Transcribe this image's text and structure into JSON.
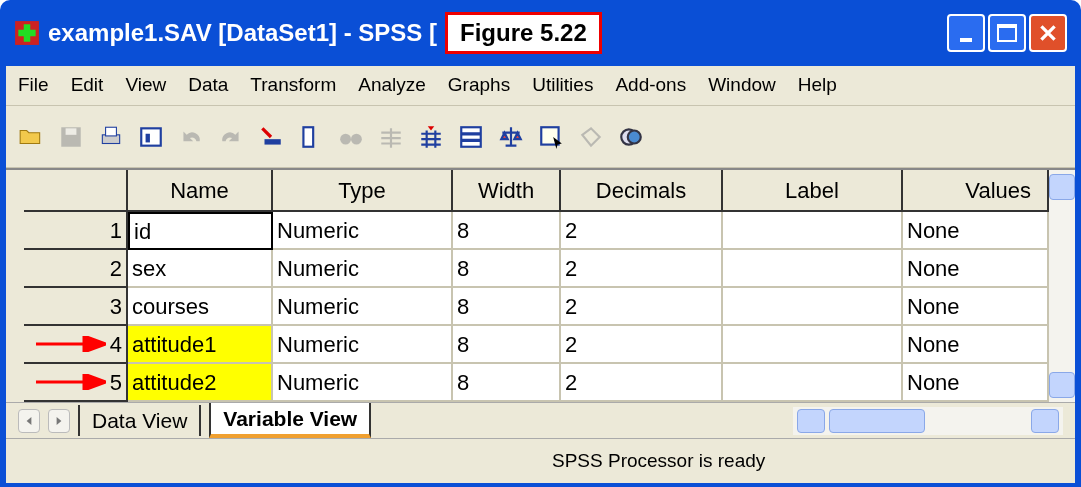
{
  "window": {
    "title": "example1.SAV [DataSet1] - SPSS [",
    "figure_label": "Figure 5.22"
  },
  "menu": [
    "File",
    "Edit",
    "View",
    "Data",
    "Transform",
    "Analyze",
    "Graphs",
    "Utilities",
    "Add-ons",
    "Window",
    "Help"
  ],
  "toolbar": [
    {
      "kind": "open",
      "disabled": false
    },
    {
      "kind": "save",
      "disabled": true
    },
    {
      "kind": "print",
      "disabled": false
    },
    {
      "kind": "dialog",
      "disabled": false
    },
    {
      "kind": "undo",
      "disabled": true
    },
    {
      "kind": "redo",
      "disabled": true
    },
    {
      "kind": "goto",
      "disabled": false
    },
    {
      "kind": "variables",
      "disabled": false
    },
    {
      "kind": "find",
      "disabled": true
    },
    {
      "kind": "insert-cases",
      "disabled": true
    },
    {
      "kind": "insert-variable",
      "disabled": false
    },
    {
      "kind": "split",
      "disabled": false
    },
    {
      "kind": "weight",
      "disabled": false
    },
    {
      "kind": "select",
      "disabled": false
    },
    {
      "kind": "labels",
      "disabled": true
    },
    {
      "kind": "sets",
      "disabled": false
    }
  ],
  "table": {
    "columns": [
      "Name",
      "Type",
      "Width",
      "Decimals",
      "Label",
      "Values"
    ],
    "rows": [
      {
        "number": "1",
        "cells": [
          "id",
          "Numeric",
          "8",
          "2",
          "",
          "None"
        ],
        "highlighted": false,
        "selected": true
      },
      {
        "number": "2",
        "cells": [
          "sex",
          "Numeric",
          "8",
          "2",
          "",
          "None"
        ],
        "highlighted": false,
        "selected": false
      },
      {
        "number": "3",
        "cells": [
          "courses",
          "Numeric",
          "8",
          "2",
          "",
          "None"
        ],
        "highlighted": false,
        "selected": false
      },
      {
        "number": "4",
        "cells": [
          "attitude1",
          "Numeric",
          "8",
          "2",
          "",
          "None"
        ],
        "highlighted": true,
        "selected": false
      },
      {
        "number": "5",
        "cells": [
          "attitude2",
          "Numeric",
          "8",
          "2",
          "",
          "None"
        ],
        "highlighted": true,
        "selected": false
      }
    ]
  },
  "tabs": [
    {
      "label": "Data View",
      "selected": false
    },
    {
      "label": "Variable View",
      "selected": true
    }
  ],
  "status_bar": "SPSS Processor is ready"
}
